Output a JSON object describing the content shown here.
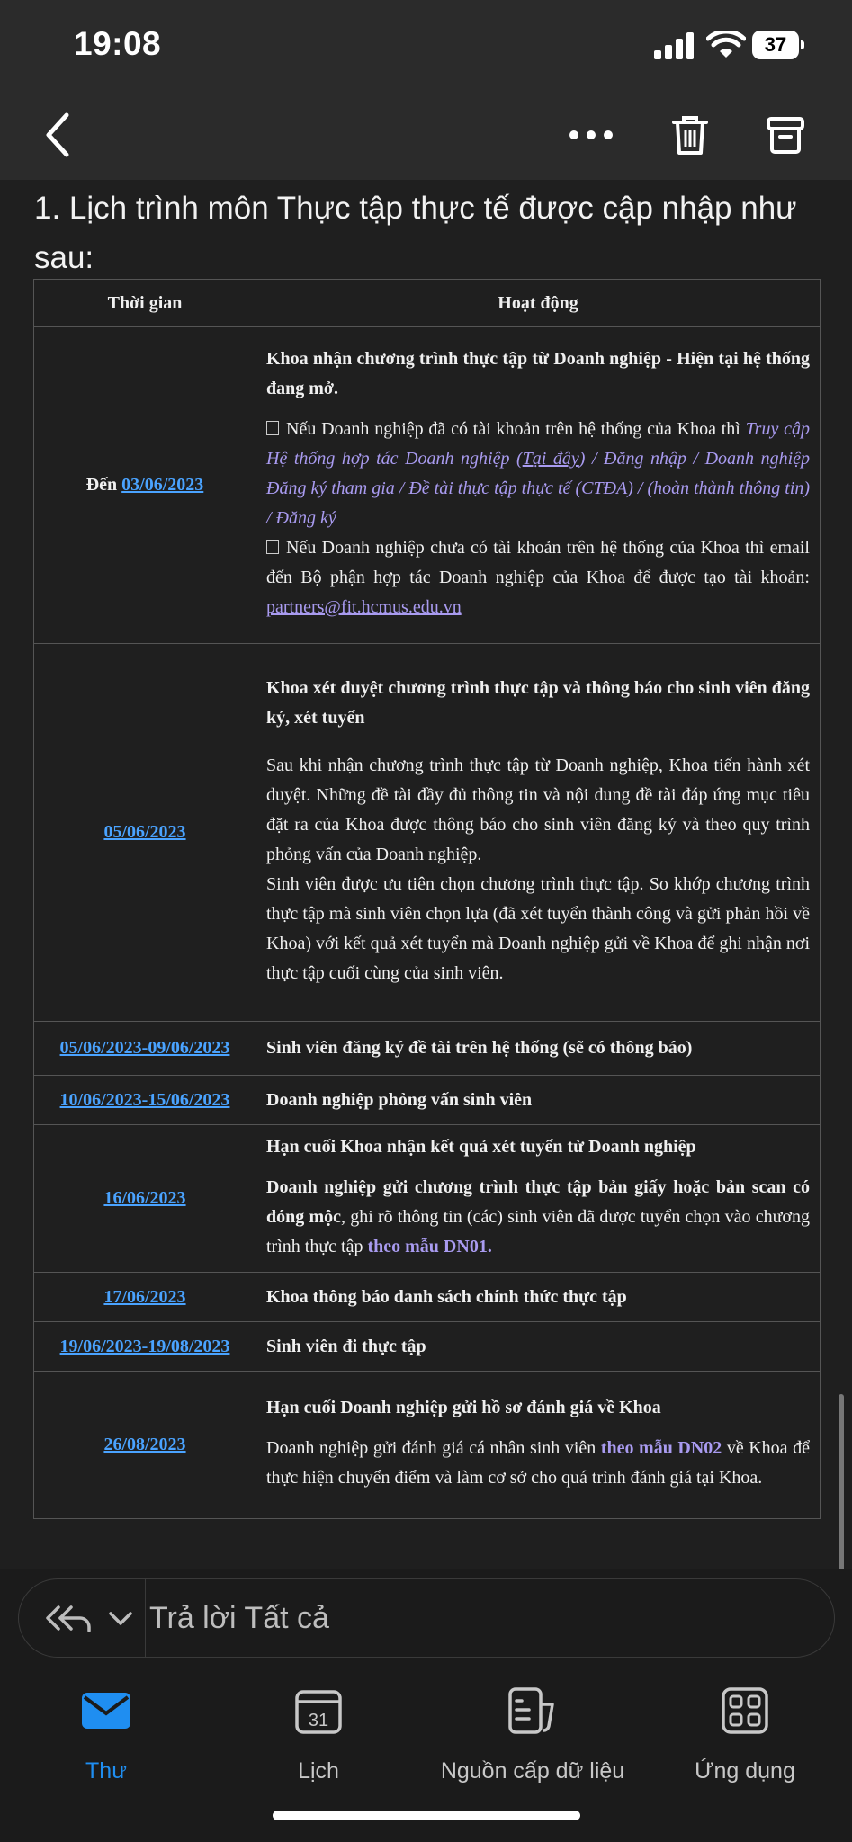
{
  "status": {
    "time": "19:08",
    "battery": "37"
  },
  "intro": "1. Lịch trình môn Thực tập thực tế được cập nhập như sau:",
  "table": {
    "headers": [
      "Thời gian",
      "Hoạt động"
    ],
    "rows": [
      {
        "date_prefix": "Đến ",
        "date": "03/06/2023",
        "title": "Khoa nhận chương trình thực tập từ Doanh nghiệp - Hiện tại hệ thống đang mở.",
        "b1_text": "Nếu Doanh nghiệp đã có tài khoản trên hệ thống của Khoa thì",
        "b1_italic_a": "Truy cập Hệ thống hợp tác Doanh nghiệp (",
        "b1_link": "Tại đây",
        "b1_italic_b": ") / Đăng nhập / Doanh nghiệp  Đăng ký tham gia / Đề tài thực tập thực tế (CTĐA) / (hoàn thành thông tin) / Đăng ký",
        "b2_text": "Nếu Doanh nghiệp chưa có tài khoản trên hệ thống của Khoa thì email đến Bộ phận hợp tác Doanh nghiệp của Khoa để được tạo tài khoản: ",
        "b2_email": "partners@fit.hcmus.edu.vn"
      },
      {
        "date": "05/06/2023",
        "title": "Khoa xét duyệt chương trình thực tập và thông báo cho sinh viên đăng ký, xét tuyển",
        "p1": "Sau khi nhận chương trình thực tập từ Doanh nghiệp, Khoa tiến hành xét duyệt. Những đề tài đầy đủ thông tin và nội dung đề tài đáp ứng mục tiêu đặt ra của Khoa được thông báo cho sinh viên đăng ký và theo quy trình phỏng vấn của Doanh nghiệp.",
        "p2": "Sinh viên được ưu tiên chọn chương trình thực tập. So khớp chương trình thực tập mà sinh viên chọn lựa (đã xét tuyển thành công và gửi phản hồi về Khoa) với kết quả xét tuyển mà Doanh nghiệp gửi về Khoa để ghi nhận nơi thực tập cuối cùng của sinh viên."
      },
      {
        "date": "05/06/2023-09/06/2023",
        "title": "Sinh viên đăng ký đề tài trên hệ thống (sẽ có thông báo)"
      },
      {
        "date": "10/06/2023-15/06/2023",
        "title": "Doanh nghiệp phỏng vấn sinh viên"
      },
      {
        "date": "16/06/2023",
        "title": "Hạn cuối Khoa nhận kết quả xét tuyển từ Doanh nghiệp",
        "p1_bold": "Doanh nghiệp gửi chương trình thực tập bản giấy hoặc bản scan có đóng mộc",
        "p1_rest": ", ghi rõ thông tin (các) sinh viên đã được tuyển chọn vào chương trình thực tập ",
        "p1_purple": "theo mẫu DN01."
      },
      {
        "date": "17/06/2023",
        "title": "Khoa thông báo danh sách chính thức thực tập"
      },
      {
        "date": "19/06/2023-19/08/2023",
        "title": "Sinh viên đi thực tập"
      },
      {
        "date": "26/08/2023",
        "title": "Hạn cuối Doanh nghiệp gửi hồ sơ đánh giá về Khoa",
        "p1_a": "Doanh nghiệp gửi đánh giá cá nhân sinh viên ",
        "p1_purple": "theo mẫu DN02",
        "p1_b": " về Khoa để thực hiện chuyển điểm và làm cơ sở cho quá trình đánh giá tại Khoa."
      }
    ]
  },
  "reply": {
    "placeholder": "Trả lời Tất cả"
  },
  "tabs": [
    {
      "label": "Thư",
      "icon": "mail-icon",
      "active": true
    },
    {
      "label": "Lịch",
      "icon": "calendar-icon",
      "day": "31"
    },
    {
      "label": "Nguồn cấp dữ liệu",
      "icon": "feed-icon"
    },
    {
      "label": "Ứng dụng",
      "icon": "apps-icon"
    }
  ],
  "colors": {
    "accent": "#1f8ef1",
    "link": "#4aa3ff",
    "purple": "#a99bf0",
    "background": "#1f1f1f"
  }
}
